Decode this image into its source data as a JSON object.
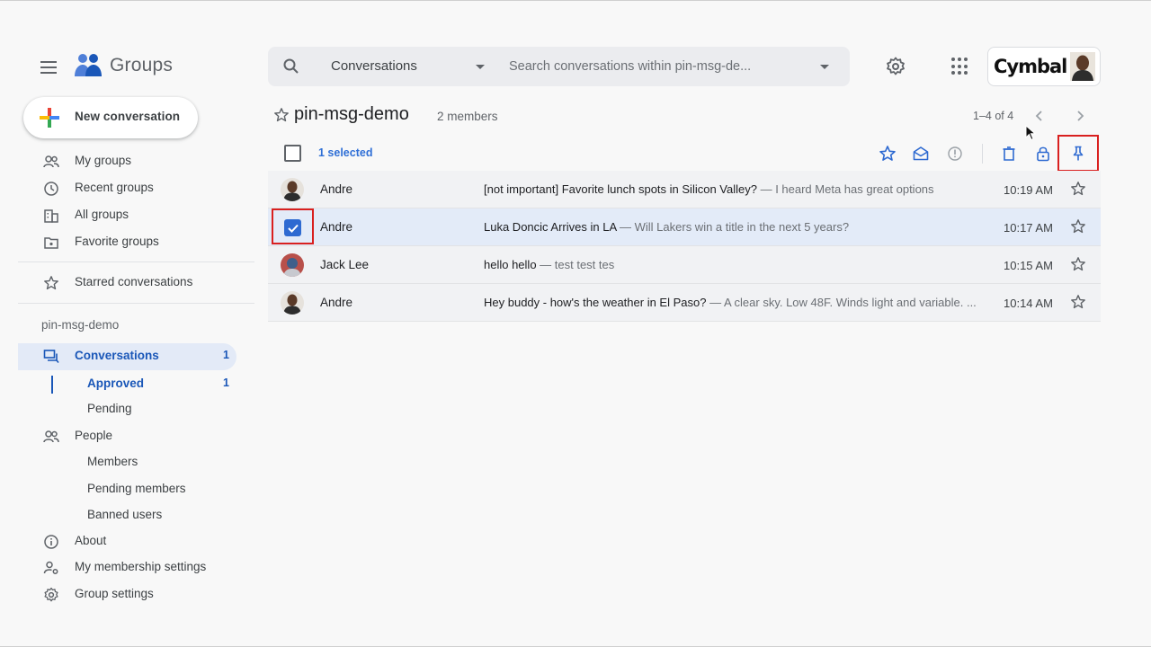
{
  "app": {
    "name": "Groups",
    "brand": "Cymbal"
  },
  "search": {
    "scope": "Conversations",
    "placeholder": "Search conversations within pin-msg-de..."
  },
  "sidebar": {
    "new_conversation": "New conversation",
    "items": [
      {
        "label": "My groups",
        "icon": "my-groups-icon"
      },
      {
        "label": "Recent groups",
        "icon": "clock-icon"
      },
      {
        "label": "All groups",
        "icon": "building-icon"
      },
      {
        "label": "Favorite groups",
        "icon": "folder-star-icon"
      },
      {
        "label": "Starred conversations",
        "icon": "star-icon"
      }
    ],
    "group_name": "pin-msg-demo",
    "group_nav": {
      "conversations": {
        "label": "Conversations",
        "count": "1"
      },
      "approved": {
        "label": "Approved",
        "count": "1"
      },
      "pending": {
        "label": "Pending"
      },
      "people": {
        "label": "People"
      },
      "members": {
        "label": "Members"
      },
      "pending_members": {
        "label": "Pending members"
      },
      "banned_users": {
        "label": "Banned users"
      },
      "about": {
        "label": "About"
      },
      "membership_settings": {
        "label": "My membership settings"
      },
      "group_settings": {
        "label": "Group settings"
      }
    }
  },
  "main": {
    "group_title": "pin-msg-demo",
    "members": "2 members",
    "pagination": "1–4 of 4",
    "selected_text": "1 selected",
    "toolbar_icons": [
      "star-icon",
      "mark-unread-icon",
      "report-icon",
      "delete-icon",
      "lock-icon",
      "pin-icon"
    ],
    "conversations": [
      {
        "author": "Andre",
        "subject": "[not important] Favorite lunch spots in Silicon Valley?",
        "snippet": " — I heard Meta has great options",
        "time": "10:19 AM",
        "selected": false
      },
      {
        "author": "Andre",
        "subject": "Luka Doncic Arrives in LA",
        "snippet": " — Will Lakers win a title in the next 5 years?",
        "time": "10:17 AM",
        "selected": true
      },
      {
        "author": "Jack Lee",
        "subject": "hello hello",
        "snippet": " — test test tes",
        "time": "10:15 AM",
        "selected": false
      },
      {
        "author": "Andre",
        "subject": "Hey buddy - how's the weather in El Paso?",
        "snippet": " — A clear sky. Low 48F. Winds light and variable. ...",
        "time": "10:14 AM",
        "selected": false
      }
    ]
  },
  "colors": {
    "accent": "#1a57b8",
    "highlight": "#d9201f",
    "selected_row": "#e3ebf8"
  }
}
